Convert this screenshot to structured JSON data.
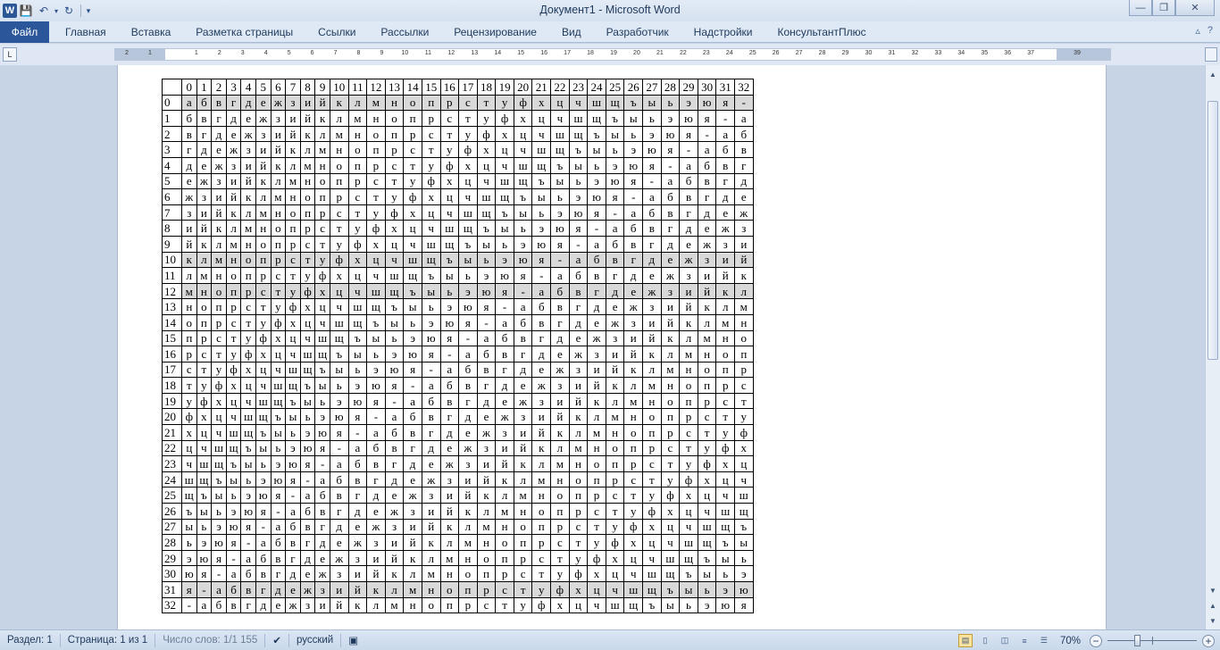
{
  "window": {
    "title": "Документ1  -  Microsoft Word",
    "app_icon": "W",
    "controls": {
      "minimize": "—",
      "maximize": "❐",
      "close": "✕"
    }
  },
  "ribbon": {
    "tabs": [
      "Файл",
      "Главная",
      "Вставка",
      "Разметка страницы",
      "Ссылки",
      "Рассылки",
      "Рецензирование",
      "Вид",
      "Разработчик",
      "Надстройки",
      "КонсультантПлюс"
    ]
  },
  "ruler": {
    "numbers": [
      "2",
      "1",
      "",
      "1",
      "2",
      "3",
      "4",
      "5",
      "6",
      "7",
      "8",
      "9",
      "10",
      "11",
      "12",
      "13",
      "14",
      "15",
      "16",
      "17",
      "18",
      "19",
      "20",
      "21",
      "22",
      "23",
      "24",
      "25",
      "26",
      "27",
      "28",
      "29",
      "30",
      "31",
      "32",
      "33",
      "34",
      "35",
      "36",
      "37",
      "",
      "39"
    ]
  },
  "table": {
    "header": [
      "",
      "0",
      "1",
      "2",
      "3",
      "4",
      "5",
      "6",
      "7",
      "8",
      "9",
      "10",
      "11",
      "12",
      "13",
      "14",
      "15",
      "16",
      "17",
      "18",
      "19",
      "20",
      "21",
      "22",
      "23",
      "24",
      "25",
      "26",
      "27",
      "28",
      "29",
      "30",
      "31",
      "32"
    ],
    "alphabet": [
      "а",
      "б",
      "в",
      "г",
      "д",
      "е",
      "ж",
      "з",
      "и",
      "й",
      "к",
      "л",
      "м",
      "н",
      "о",
      "п",
      "р",
      "с",
      "т",
      "у",
      "ф",
      "х",
      "ц",
      "ч",
      "ш",
      "щ",
      "ъ",
      "ы",
      "ь",
      "э",
      "ю",
      "я",
      "-"
    ],
    "row_labels": [
      "0",
      "1",
      "2",
      "3",
      "4",
      "5",
      "6",
      "7",
      "8",
      "9",
      "10",
      "11",
      "12",
      "13",
      "14",
      "15",
      "16",
      "17",
      "18",
      "19",
      "20",
      "21",
      "22",
      "23",
      "24",
      "25",
      "26",
      "27",
      "28",
      "29",
      "30",
      "31",
      "32"
    ],
    "shaded_rows": [
      0,
      10,
      12,
      31
    ]
  },
  "statusbar": {
    "section": "Раздел: 1",
    "page": "Страница: 1 из 1",
    "words": "Число слов: 1/1 155",
    "language": "русский",
    "zoom": "70%",
    "zoom_value": 70
  }
}
